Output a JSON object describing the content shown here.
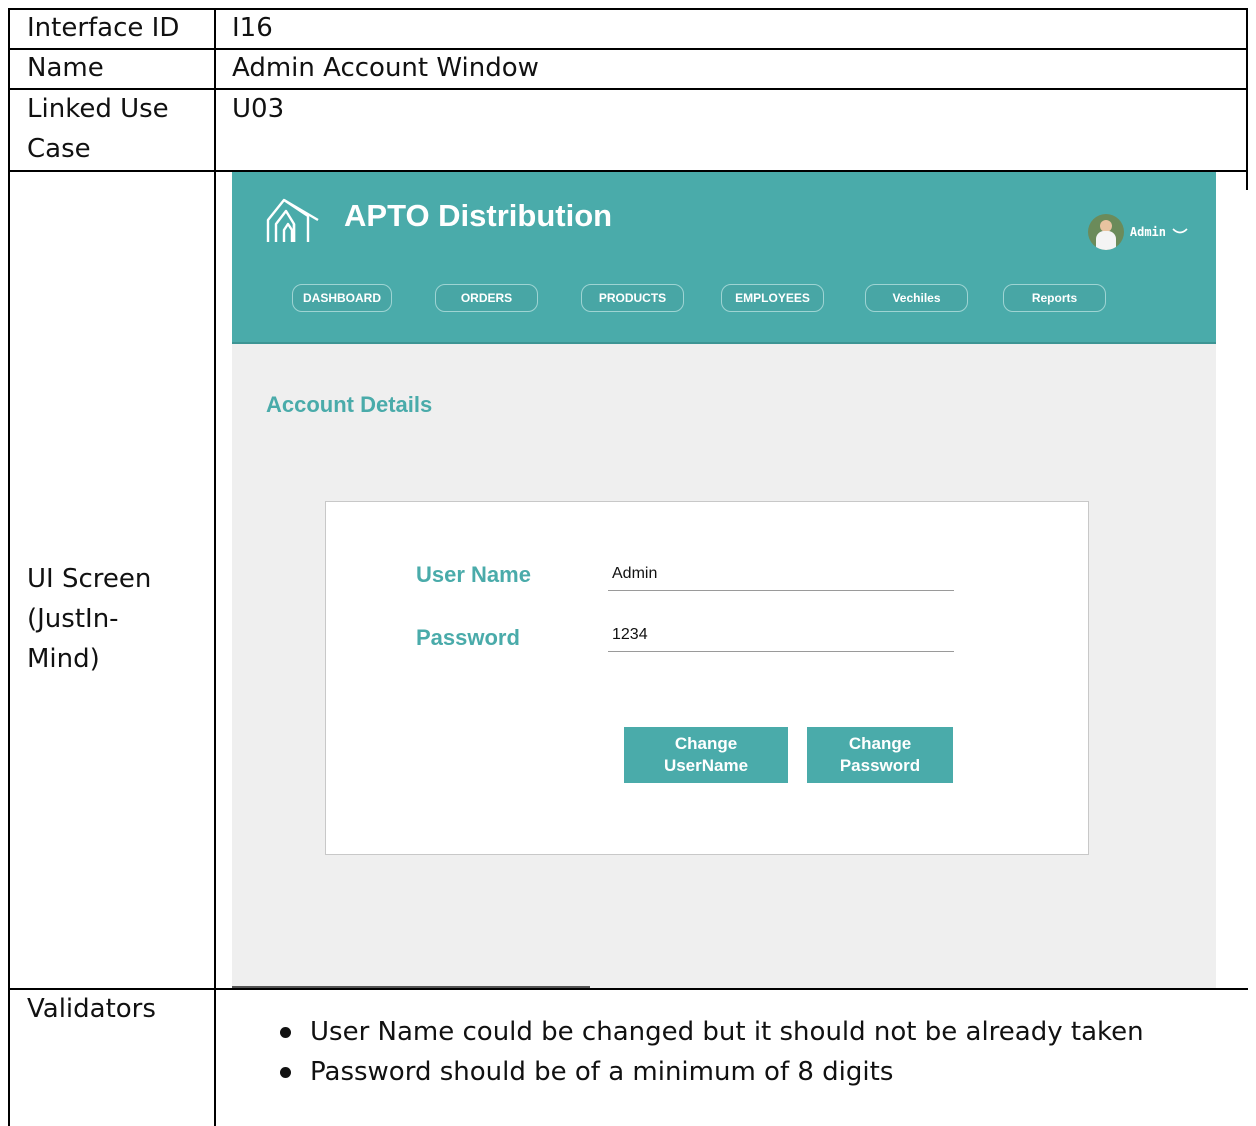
{
  "document": {
    "rows": [
      {
        "label": "Interface ID",
        "value": "I16"
      },
      {
        "label": "Name",
        "value": "Admin Account Window"
      },
      {
        "label_lines": [
          "Linked Use",
          "Case"
        ],
        "value": "U03"
      },
      {
        "label_lines": [
          "UI Screen",
          "(JustIn-",
          "Mind)"
        ]
      },
      {
        "label": "Validators"
      }
    ],
    "validators": [
      "User Name could be changed but it should not be already taken",
      "Password should be of a minimum of 8 digits"
    ]
  },
  "mockup": {
    "brand": "APTO Distribution",
    "user": {
      "name": "Admin"
    },
    "nav": [
      "DASHBOARD",
      "ORDERS",
      "PRODUCTS",
      "EMPLOYEES",
      "Vechiles",
      "Reports"
    ],
    "section_title": "Account Details",
    "form": {
      "username_label": "User Name",
      "username_value": "Admin",
      "password_label": "Password",
      "password_value": "1234"
    },
    "buttons": {
      "change_username": [
        "Change",
        "UserName"
      ],
      "change_password": [
        "Change",
        "Password"
      ]
    },
    "colors": {
      "accent": "#4aabaa",
      "page_bg": "#efefef"
    },
    "icons": {
      "logo": "house-arches-logo-icon",
      "avatar": "user-avatar-icon",
      "chevron": "chevron-down-icon"
    }
  }
}
